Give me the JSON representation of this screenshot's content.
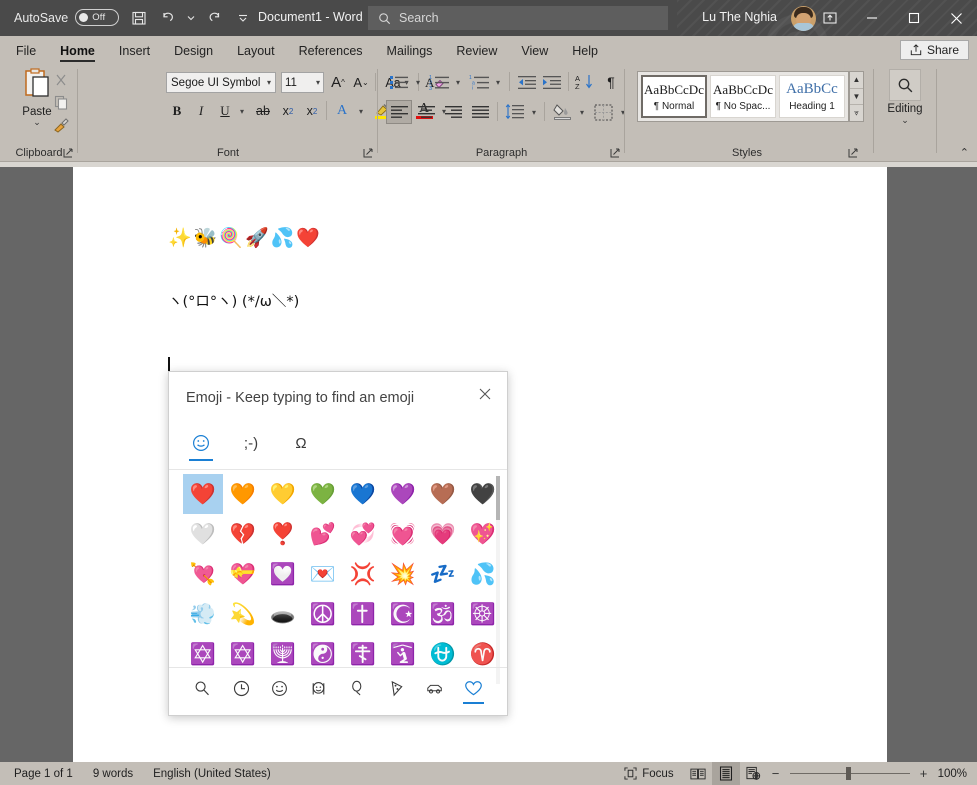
{
  "titlebar": {
    "autosave_label": "AutoSave",
    "autosave_state": "Off",
    "document_title": "Document1  -  Word",
    "search_placeholder": "Search",
    "user_name": "Lu The Nghia",
    "quick_access": [
      {
        "name": "save-button",
        "label": "Save"
      },
      {
        "name": "undo-button",
        "label": "Undo"
      },
      {
        "name": "redo-button",
        "label": "Redo"
      },
      {
        "name": "customize-quick-access-button",
        "label": "Customize Quick Access Toolbar"
      }
    ],
    "window_controls": [
      {
        "name": "minimize-button",
        "label": "Minimize"
      },
      {
        "name": "maximize-button",
        "label": "Maximize"
      },
      {
        "name": "close-button",
        "label": "Close"
      }
    ],
    "ribbon_display_options_label": "Ribbon Display Options"
  },
  "tabs": [
    {
      "label": "File",
      "active": false
    },
    {
      "label": "Home",
      "active": true
    },
    {
      "label": "Insert",
      "active": false
    },
    {
      "label": "Design",
      "active": false
    },
    {
      "label": "Layout",
      "active": false
    },
    {
      "label": "References",
      "active": false
    },
    {
      "label": "Mailings",
      "active": false
    },
    {
      "label": "Review",
      "active": false
    },
    {
      "label": "View",
      "active": false
    },
    {
      "label": "Help",
      "active": false
    }
  ],
  "share_label": "Share",
  "ribbon": {
    "groups": [
      {
        "name": "clipboard",
        "label": "Clipboard"
      },
      {
        "name": "font",
        "label": "Font"
      },
      {
        "name": "paragraph",
        "label": "Paragraph"
      },
      {
        "name": "styles",
        "label": "Styles"
      }
    ],
    "clipboard": {
      "paste_label": "Paste",
      "cut_label": "Cut",
      "copy_label": "Copy",
      "format_painter_label": "Format Painter"
    },
    "font": {
      "font_name": "Segoe UI Symbol",
      "font_size": "11",
      "grow_font_label": "Grow Font",
      "shrink_font_label": "Shrink Font",
      "change_case_label": "Aa",
      "clear_formatting_label": "Clear All Formatting",
      "bold_label": "B",
      "italic_label": "I",
      "underline_label": "U",
      "strikethrough_label": "ab",
      "subscript_label": "x",
      "superscript_label": "x",
      "text_effects_label": "A",
      "highlight_label": "Text Highlight Color",
      "font_color_label": "A"
    },
    "paragraph": {
      "bullets_label": "Bullets",
      "numbering_label": "Numbering",
      "multilevel_label": "Multilevel List",
      "decrease_indent_label": "Decrease Indent",
      "increase_indent_label": "Increase Indent",
      "sort_label": "Sort",
      "show_marks_label": "¶",
      "align_left_label": "Align Left",
      "align_center_label": "Center",
      "align_right_label": "Align Right",
      "justify_label": "Justify",
      "line_spacing_label": "Line and Paragraph Spacing",
      "shading_label": "Shading",
      "borders_label": "Borders"
    },
    "styles": {
      "items": [
        {
          "preview": "AaBbCcDc",
          "name": "¶ Normal",
          "selected": true,
          "heading": false
        },
        {
          "preview": "AaBbCcDc",
          "name": "¶ No Spac...",
          "selected": false,
          "heading": false
        },
        {
          "preview": "AaBbCc",
          "name": "Heading 1",
          "selected": false,
          "heading": true
        }
      ],
      "scroll_up_label": "Scroll Up",
      "scroll_down_label": "Scroll Down",
      "more_label": "More"
    },
    "editing": {
      "label": "Editing",
      "icon": "search-icon"
    },
    "collapse_ribbon_label": "Collapse the Ribbon"
  },
  "document": {
    "line1_emoji": "✨🐝🍭🚀💦❤️",
    "line2_kaomoji": "ヽ(°ロ°ヽ)  (*/ω＼*)"
  },
  "emoji_panel": {
    "title": "Emoji - Keep typing to find an emoji",
    "close_label": "×",
    "tabs": [
      {
        "name": "tab-emoji",
        "glyph": "☺",
        "active": true
      },
      {
        "name": "tab-kaomoji",
        "glyph": ";-)",
        "active": false
      },
      {
        "name": "tab-symbols",
        "glyph": "Ω",
        "active": false
      }
    ],
    "grid": [
      {
        "glyph": "❤️",
        "name": "red-heart",
        "selected": true
      },
      {
        "glyph": "🧡",
        "name": "orange-heart",
        "selected": false
      },
      {
        "glyph": "💛",
        "name": "yellow-heart",
        "selected": false
      },
      {
        "glyph": "💚",
        "name": "green-heart",
        "selected": false
      },
      {
        "glyph": "💙",
        "name": "blue-heart",
        "selected": false
      },
      {
        "glyph": "💜",
        "name": "purple-heart",
        "selected": false
      },
      {
        "glyph": "🤎",
        "name": "brown-heart",
        "selected": false
      },
      {
        "glyph": "🖤",
        "name": "black-heart",
        "selected": false
      },
      {
        "glyph": "🤍",
        "name": "white-heart",
        "selected": false
      },
      {
        "glyph": "💔",
        "name": "broken-heart",
        "selected": false
      },
      {
        "glyph": "❣️",
        "name": "heart-exclamation",
        "selected": false
      },
      {
        "glyph": "💕",
        "name": "two-hearts",
        "selected": false
      },
      {
        "glyph": "💞",
        "name": "revolving-hearts",
        "selected": false
      },
      {
        "glyph": "💓",
        "name": "beating-heart",
        "selected": false
      },
      {
        "glyph": "💗",
        "name": "growing-heart",
        "selected": false
      },
      {
        "glyph": "💖",
        "name": "sparkling-heart",
        "selected": false
      },
      {
        "glyph": "💘",
        "name": "heart-with-arrow",
        "selected": false
      },
      {
        "glyph": "💝",
        "name": "heart-with-ribbon",
        "selected": false
      },
      {
        "glyph": "💟",
        "name": "heart-decoration",
        "selected": false
      },
      {
        "glyph": "💌",
        "name": "love-letter",
        "selected": false
      },
      {
        "glyph": "💢",
        "name": "anger-symbol",
        "selected": false
      },
      {
        "glyph": "💥",
        "name": "collision",
        "selected": false
      },
      {
        "glyph": "💤",
        "name": "zzz",
        "selected": false
      },
      {
        "glyph": "💦",
        "name": "sweat-droplets",
        "selected": false
      },
      {
        "glyph": "💨",
        "name": "dashing-away",
        "selected": false
      },
      {
        "glyph": "💫",
        "name": "dizzy",
        "selected": false
      },
      {
        "glyph": "🕳️",
        "name": "hole",
        "selected": false
      },
      {
        "glyph": "☮️",
        "name": "peace-symbol",
        "selected": false
      },
      {
        "glyph": "✝️",
        "name": "latin-cross",
        "selected": false
      },
      {
        "glyph": "☪️",
        "name": "star-and-crescent",
        "selected": false
      },
      {
        "glyph": "🕉️",
        "name": "om",
        "selected": false
      },
      {
        "glyph": "☸️",
        "name": "wheel-of-dharma",
        "selected": false
      },
      {
        "glyph": "✡️",
        "name": "star-of-david",
        "selected": false
      },
      {
        "glyph": "✡️",
        "name": "star-of-david-alt",
        "selected": false
      },
      {
        "glyph": "🕎",
        "name": "menorah",
        "selected": false
      },
      {
        "glyph": "☯️",
        "name": "yin-yang",
        "selected": false
      },
      {
        "glyph": "☦️",
        "name": "orthodox-cross",
        "selected": false
      },
      {
        "glyph": "🛐",
        "name": "place-of-worship",
        "selected": false
      },
      {
        "glyph": "⛎",
        "name": "ophiuchus",
        "selected": false
      },
      {
        "glyph": "♈️",
        "name": "aries",
        "selected": false
      }
    ],
    "categories": [
      {
        "name": "search-icon",
        "label": "Search",
        "active": false
      },
      {
        "name": "clock-icon",
        "label": "Recently used",
        "active": false
      },
      {
        "name": "smiley-icon",
        "label": "Smiley faces",
        "active": false
      },
      {
        "name": "people-icon",
        "label": "People",
        "active": false
      },
      {
        "name": "balloon-icon",
        "label": "Celebration",
        "active": false
      },
      {
        "name": "pizza-icon",
        "label": "Food",
        "active": false
      },
      {
        "name": "car-icon",
        "label": "Transportation",
        "active": false
      },
      {
        "name": "heart-icon",
        "label": "Symbols",
        "active": true
      }
    ]
  },
  "statusbar": {
    "page": "Page 1 of 1",
    "words": "9 words",
    "language": "English (United States)",
    "focus_label": "Focus",
    "views": [
      {
        "name": "read-mode-button",
        "label": "Read Mode",
        "selected": false
      },
      {
        "name": "print-layout-button",
        "label": "Print Layout",
        "selected": true
      },
      {
        "name": "web-layout-button",
        "label": "Web Layout",
        "selected": false
      }
    ],
    "zoom_out_label": "−",
    "zoom_in_label": "+",
    "zoom_level": "100%"
  }
}
